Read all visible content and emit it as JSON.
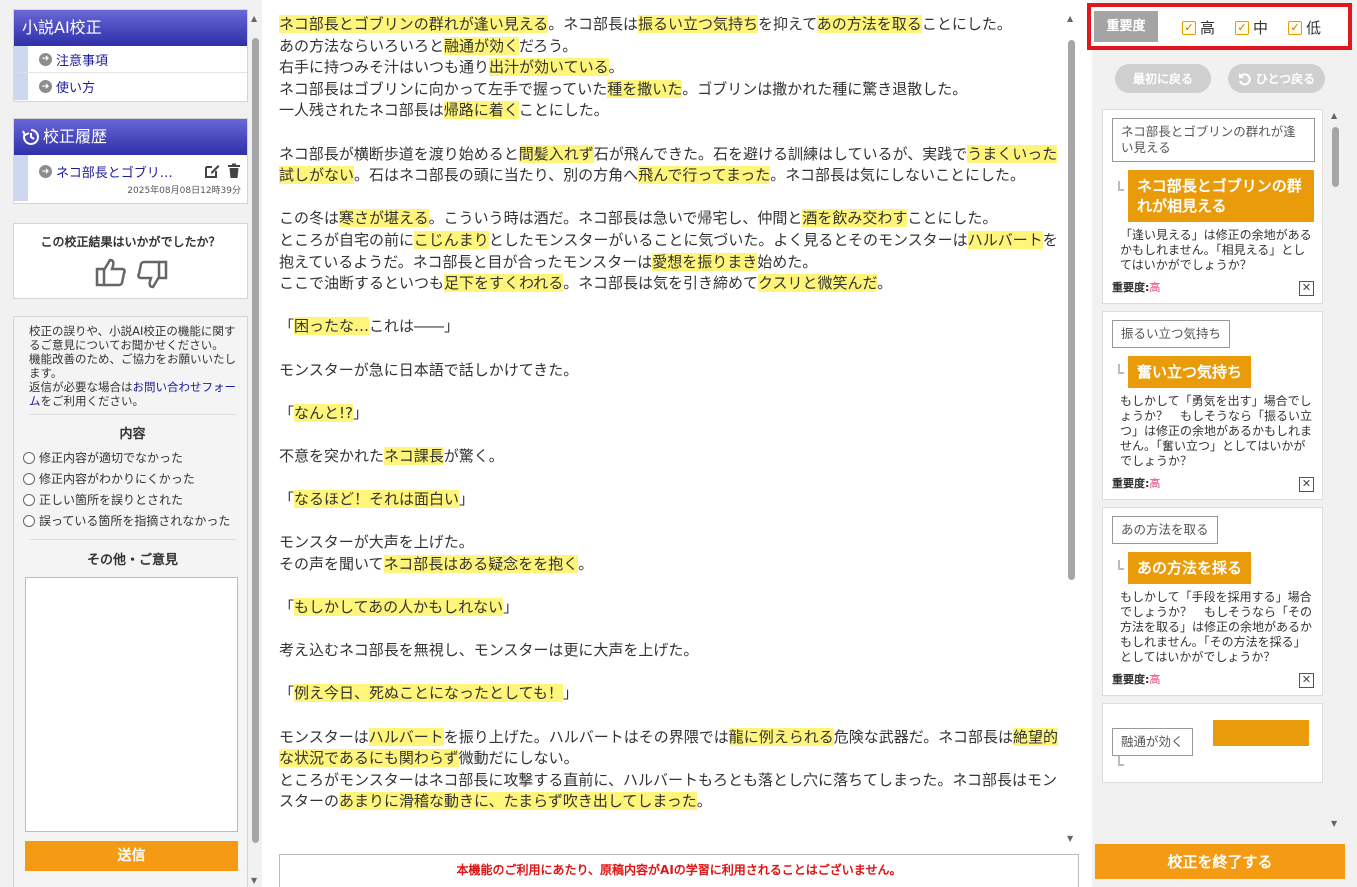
{
  "sidebar": {
    "app_title": "小説AI校正",
    "menu": [
      {
        "label": "注意事項"
      },
      {
        "label": "使い方"
      }
    ],
    "history_title": "校正履歴",
    "history_item": {
      "title": "ネコ部長とゴブリ…",
      "date": "2025年08月08日12時39分"
    },
    "rating_question": "この校正結果はいかがでしたか？",
    "feedback": {
      "intro_line1": "校正の誤りや、小説AI校正の機能に関するご意見についてお聞かせください。",
      "intro_line2": "機能改善のため、ご協力をお願いいたします。",
      "intro_line3_pre": "返信が必要な場合は",
      "intro_link": "お問い合わせフォーム",
      "intro_line3_post": "をご利用ください。",
      "content_title": "内容",
      "options": [
        "修正内容が適切でなかった",
        "修正内容がわかりにくかった",
        "正しい箇所を誤りとされた",
        "誤っている箇所を指摘されなかった"
      ],
      "other_title": "その他・ご意見",
      "submit": "送信"
    }
  },
  "main": {
    "notice": "本機能のご利用にあたり、原稿内容がAIの学習に利用されることはございません。",
    "p1": [
      [
        "ネコ部長とゴブリンの群れが逢い見える",
        "。ネコ部長は",
        "振るい立つ気持ち",
        "を抑えて",
        "あの方法を取る",
        "ことにした。"
      ],
      [
        "あの方法ならいろいろと",
        "融通が効く",
        "だろう。"
      ],
      [
        "右手に持つみそ汁はいつも通り",
        "出汁が効いている",
        "。"
      ],
      [
        "ネコ部長はゴブリンに向かって左手で握っていた",
        "種を撒いた",
        "。ゴブリンは撒かれた種に驚き退散した。"
      ],
      [
        "一人残されたネコ部長は",
        "帰路に着く",
        "ことにした。"
      ]
    ],
    "p2": [
      "ネコ部長が横断歩道を渡り始めると",
      "間髪入れず",
      "石が飛んできた。石を避ける訓練はしているが、実践で",
      "うまくいった試しがない",
      "。石はネコ部長の頭に当たり、別の方角へ",
      "飛んで行ってまった",
      "。ネコ部長は気にしないことにした。"
    ],
    "p3": [
      [
        "この冬は",
        "寒さが堪える",
        "。こういう時は酒だ。ネコ部長は急いで帰宅し、仲間と",
        "酒を飲み交わす",
        "ことにした。"
      ],
      [
        "ところが自宅の前に",
        "こじんまり",
        "としたモンスターがいることに気づいた。よく見るとそのモンスターは",
        "ハルバート",
        "を抱えているようだ。ネコ部長と目が合ったモンスターは",
        "愛想を振りまき",
        "始めた。"
      ],
      [
        "ここで油断するといつも",
        "足下をすくわれる",
        "。ネコ部長は気を引き締めて",
        "クスリと微笑んだ",
        "。"
      ]
    ],
    "q1": [
      "「",
      "困ったな…",
      "これは――」"
    ],
    "l1": "モンスターが急に日本語で話しかけてきた。",
    "q2": [
      "「",
      "なんと!?",
      "」"
    ],
    "l2": [
      "不意を突かれた",
      "ネコ課長",
      "が驚く。"
    ],
    "q3": [
      "「",
      "なるほど！それは面白い",
      "」"
    ],
    "l3a": "モンスターが大声を上げた。",
    "l3b": [
      "その声を聞いて",
      "ネコ部長はある疑念をを抱く",
      "。"
    ],
    "q4": [
      "「",
      "もしかしてあの人かもしれない",
      "」"
    ],
    "l4": "考え込むネコ部長を無視し、モンスターは更に大声を上げた。",
    "q5": [
      "「",
      "例え今日、死ぬことになったとしても！",
      "」"
    ],
    "l5a": [
      "モンスターは",
      "ハルバート",
      "を振り上げた。ハルバートはその界隈では",
      "龍に例えられる",
      "危険な武器だ。ネコ部長は",
      "絶望的な状況であるにも関わらず",
      "微動だにしない。"
    ],
    "l5b": [
      "ところがモンスターはネコ部長に攻撃する直前に、ハルバートもろとも落とし穴に落ちてしまった。ネコ部長はモンスターの",
      "あまりに滑稽な動きに、たまらず吹き出してしまった",
      "。"
    ]
  },
  "filter": {
    "label": "重要度",
    "options": [
      {
        "label": "高",
        "checked": true
      },
      {
        "label": "中",
        "checked": true
      },
      {
        "label": "低",
        "checked": true
      }
    ]
  },
  "nav": {
    "first": "最初に戻る",
    "back": "ひとつ戻る"
  },
  "cards": [
    {
      "original": "ネコ部長とゴブリンの群れが逢い見える",
      "suggestion": "ネコ部長とゴブリンの群れが相見える",
      "explanation": "「逢い見える」は修正の余地があるかもしれません。「相見える」としてはいかがでしょうか？",
      "importance_label": "重要度:",
      "importance": "高"
    },
    {
      "original": "振るい立つ気持ち",
      "suggestion": "奮い立つ気持ち",
      "explanation": "もしかして「勇気を出す」場合でしょうか？　もしそうなら「振るい立つ」は修正の余地があるかもしれません。「奮い立つ」としてはいかがでしょうか？",
      "importance_label": "重要度:",
      "importance": "高"
    },
    {
      "original": "あの方法を取る",
      "suggestion": "あの方法を採る",
      "explanation": "もしかして「手段を採用する」場合でしょうか？　もしそうなら「その方法を取る」は修正の余地があるかもしれません。「その方法を採る」としてはいかがでしょうか？",
      "importance_label": "重要度:",
      "importance": "高"
    },
    {
      "original": "融通が効く",
      "suggestion": "",
      "explanation": "",
      "importance_label": "",
      "importance": ""
    }
  ],
  "finish": "校正を終了する",
  "colors": {
    "accent_orange": "#f59b13",
    "highlight": "#fff57a",
    "header_blue": "#3a3ab4",
    "filter_border": "#e3161b"
  }
}
